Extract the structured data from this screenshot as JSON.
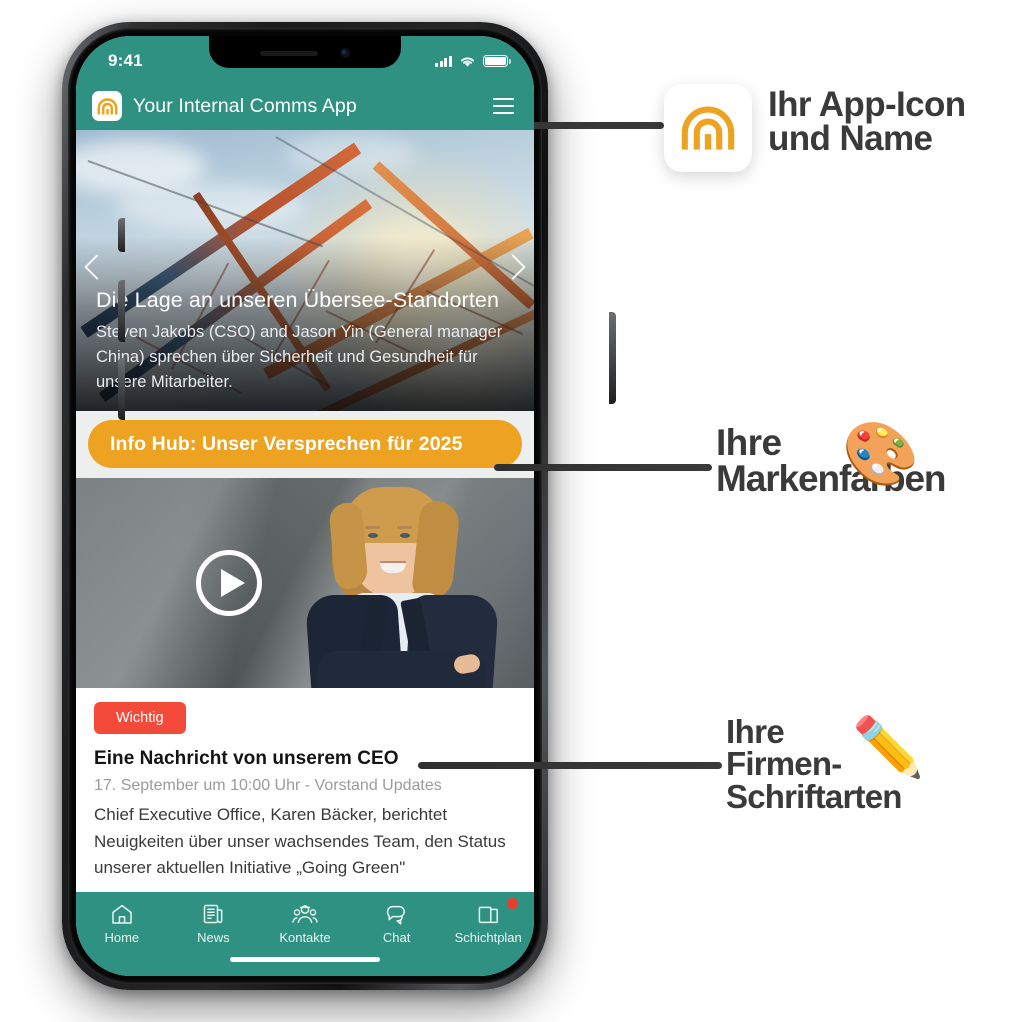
{
  "phone": {
    "status_bar": {
      "time": "9:41",
      "signal_icon": "cellular-bars-icon",
      "wifi_icon": "wifi-icon",
      "battery_icon": "battery-full-icon"
    },
    "app_bar": {
      "icon_name": "rainbow-arch-app-icon",
      "title": "Your Internal Comms App",
      "menu_icon": "hamburger-menu-icon"
    },
    "hero": {
      "title": "Die Lage an unseren Übersee-Standorten",
      "subtitle": "Steven Jakobs (CSO) and Jason Yin (General manager China) sprechen über Sicherheit und Gesundheit für unsere Mitarbeiter.",
      "prev_icon": "chevron-left-icon",
      "next_icon": "chevron-right-icon"
    },
    "cta": {
      "label": "Info Hub: Unser Versprechen für 2025",
      "color": "#EDA321"
    },
    "video": {
      "play_icon": "play-circle-icon",
      "alt": "CEO portrait video thumbnail"
    },
    "article": {
      "badge": "Wichtig",
      "badge_color": "#F44A3A",
      "title": "Eine Nachricht von unserem CEO",
      "meta": "17. September um 10:00 Uhr - Vorstand Updates",
      "body": "Chief Executive Office, Karen Bäcker, berichtet Neuigkeiten über unser wachsendes Team, den Status unserer aktuellen Initiative „Going Green\""
    },
    "tab_bar": {
      "accent": "#2E9182",
      "items": [
        {
          "label": "Home",
          "icon": "home-icon",
          "badge": false
        },
        {
          "label": "News",
          "icon": "news-icon",
          "badge": false
        },
        {
          "label": "Kontakte",
          "icon": "contacts-icon",
          "badge": false
        },
        {
          "label": "Chat",
          "icon": "chat-icon",
          "badge": false
        },
        {
          "label": "Schichtplan",
          "icon": "shifts-icon",
          "badge": true
        }
      ]
    }
  },
  "callouts": [
    {
      "line1": "Ihr App-Icon",
      "line2": "und Name",
      "line3": "",
      "icon": "rainbow-arch-app-icon"
    },
    {
      "line1": "Ihre",
      "line2": "Markenfarben",
      "line3": "",
      "icon": "palette-emoji",
      "glyph": "🎨"
    },
    {
      "line1": "Ihre",
      "line2": "Firmen-",
      "line3": "Schriftarten",
      "icon": "pencil-emoji",
      "glyph": "✏️"
    }
  ],
  "colors": {
    "brand_teal": "#2E9182",
    "brand_orange": "#EDA321",
    "alert_red": "#F44A3A",
    "callout_text": "#3A3A3A"
  }
}
